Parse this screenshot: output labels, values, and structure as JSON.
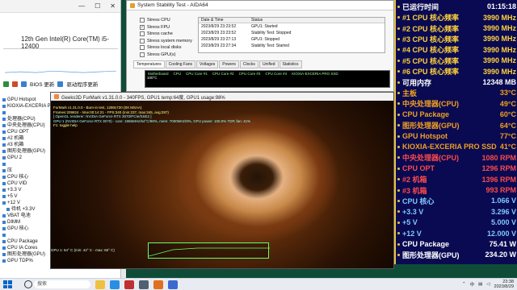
{
  "left_window": {
    "controls": [
      "—",
      "☐",
      "✕"
    ],
    "cpu_name": "12th Gen Intel(R) Core(TM) i5-12400",
    "toolbar": {
      "bios_update": "BIOS 更新",
      "driver_update": "驱动程序更新"
    },
    "tree": [
      {
        "label": "GPU Hotspot",
        "indent": false
      },
      {
        "label": "KIOXIA-EXCERIA PRO SSD",
        "indent": false
      },
      {
        "label": "",
        "indent": false
      },
      {
        "label": "处理器(CPU)",
        "indent": false
      },
      {
        "label": "中央处理器(CPU)",
        "indent": false
      },
      {
        "label": "CPU OPT",
        "indent": false
      },
      {
        "label": "#2 机箱",
        "indent": false
      },
      {
        "label": "#3 机箱",
        "indent": false
      },
      {
        "label": "图形处理器(GPU)",
        "indent": false
      },
      {
        "label": "GPU 2",
        "indent": false
      },
      {
        "label": "",
        "indent": false
      },
      {
        "label": "压",
        "indent": false
      },
      {
        "label": "CPU 核心",
        "indent": false
      },
      {
        "label": "CPU VID",
        "indent": false
      },
      {
        "label": "+3.3 V",
        "indent": false
      },
      {
        "label": "+5 V",
        "indent": false
      },
      {
        "label": "+12 V",
        "indent": false
      },
      {
        "label": "待机 +3.3V",
        "indent": true
      },
      {
        "label": "VBAT 电池",
        "indent": false
      },
      {
        "label": "DIMM",
        "indent": false
      },
      {
        "label": "GPU 核心",
        "indent": false
      },
      {
        "label": "",
        "indent": false
      },
      {
        "label": "CPU Package",
        "indent": false
      },
      {
        "label": "CPU IA Cores",
        "indent": false
      },
      {
        "label": "图形处理器(GPU)",
        "indent": false
      },
      {
        "label": "GPU TDP%",
        "indent": false
      }
    ]
  },
  "aida": {
    "title": "System Stability Test - AIDA64",
    "checks": [
      {
        "label": "Stress CPU",
        "checked": false
      },
      {
        "label": "Stress FPU",
        "checked": true
      },
      {
        "label": "Stress cache",
        "checked": false
      },
      {
        "label": "Stress system memory",
        "checked": false
      },
      {
        "label": "Stress local disks",
        "checked": false
      },
      {
        "label": "Stress GPU(s)",
        "checked": false
      }
    ],
    "log_headers": [
      "Date & Time",
      "Status"
    ],
    "log_rows": [
      {
        "time": "2023/8/29 23:23:52",
        "status": "GPU1: Started"
      },
      {
        "time": "2023/8/29 23:23:52",
        "status": "Stability Test: Stopped"
      },
      {
        "time": "2023/8/29 23:27:13",
        "status": "GPU1: Stopped"
      },
      {
        "time": "2023/8/29 23:27:34",
        "status": "Stability Test: Started"
      }
    ],
    "tabs": [
      "Temperatures",
      "Cooling Fans",
      "Voltages",
      "Powers",
      "Clocks",
      "Unified",
      "Statistics"
    ],
    "graph_legend": [
      "Motherboard",
      "CPU",
      "CPU Core #1",
      "CPU Core #2",
      "CPU Core #3",
      "CPU Core #4",
      "KIOXIA-EXCERIA PRO SSD"
    ],
    "graph_value": "100°C"
  },
  "furmark": {
    "title": "Geeks3D FurMark v1.31.0.0 - 340FPS, GPU1 temp:64度, GPU1 usage:98%",
    "info_lines": [
      "FurMark v1.31.0.0 - Burn-in test, 1280x720 (8X MSAA)",
      "Frames:209824 - time:00:14:21 - FPS:340 (min:237, max:345, avg:287)"
    ],
    "gpu_lines": [
      "[ OpenGL renderer: NVIDIA GeForce RTX 3070/PCIe/SSE2 ]",
      "GPU 1 (NVIDIA GeForce RTX 3070) - core: 1965MHz/64°C/98%, mem: 7000MHz/9%, GPU power: 100.0% TDP, fan: 41%",
      "F1: toggle help"
    ],
    "temp_readout": "GPU 1: 64° C (min: 42° C - max: 65° C)"
  },
  "osd": {
    "colors": {
      "bg": "#0a0a52",
      "accent": "#e8c24a"
    },
    "rows": [
      {
        "label": "已运行时间",
        "value": "01:15:18",
        "color": "#ffffff"
      },
      {
        "label": "#1 CPU 核心频率",
        "value": "3990 MHz",
        "color": "#ffd23a"
      },
      {
        "label": "#2 CPU 核心频率",
        "value": "3990 MHz",
        "color": "#ffd23a"
      },
      {
        "label": "#3 CPU 核心频率",
        "value": "3990 MHz",
        "color": "#ffd23a"
      },
      {
        "label": "#4 CPU 核心频率",
        "value": "3990 MHz",
        "color": "#ffd23a"
      },
      {
        "label": "#5 CPU 核心频率",
        "value": "3990 MHz",
        "color": "#ffd23a"
      },
      {
        "label": "#6 CPU 核心频率",
        "value": "3990 MHz",
        "color": "#ffd23a"
      },
      {
        "label": "可用内存",
        "value": "12348 MB",
        "color": "#ffffff"
      },
      {
        "label": "主板",
        "value": "33°C",
        "color": "#f0a020"
      },
      {
        "label": "中央处理器(CPU)",
        "value": "49°C",
        "color": "#f0a020"
      },
      {
        "label": "CPU Package",
        "value": "60°C",
        "color": "#f0a020"
      },
      {
        "label": "图形处理器(GPU)",
        "value": "64°C",
        "color": "#f0a020"
      },
      {
        "label": "GPU Hotspot",
        "value": "77°C",
        "color": "#f0a020"
      },
      {
        "label": "KIOXIA-EXCERIA PRO SSD",
        "value": "41°C",
        "color": "#f0a020"
      },
      {
        "label": "中央处理器(CPU)",
        "value": "1080 RPM",
        "color": "#ff4a4a"
      },
      {
        "label": "CPU OPT",
        "value": "1296 RPM",
        "color": "#ff4a4a"
      },
      {
        "label": "#2 机箱",
        "value": "1396 RPM",
        "color": "#ff4a4a"
      },
      {
        "label": "#3 机箱",
        "value": "993 RPM",
        "color": "#ff4a4a"
      },
      {
        "label": "CPU 核心",
        "value": "1.066 V",
        "color": "#7ec8ff"
      },
      {
        "label": "+3.3 V",
        "value": "3.296 V",
        "color": "#7ec8ff"
      },
      {
        "label": "+5 V",
        "value": "5.000 V",
        "color": "#7ec8ff"
      },
      {
        "label": "+12 V",
        "value": "12.000 V",
        "color": "#7ec8ff"
      },
      {
        "label": "CPU Package",
        "value": "75.41 W",
        "color": "#ffffff"
      },
      {
        "label": "图形处理器(GPU)",
        "value": "234.20 W",
        "color": "#ffffff"
      }
    ]
  },
  "taskbar": {
    "search_placeholder": "搜索",
    "tray_lang": "中",
    "time": "23:38",
    "date": "2023/8/29"
  }
}
